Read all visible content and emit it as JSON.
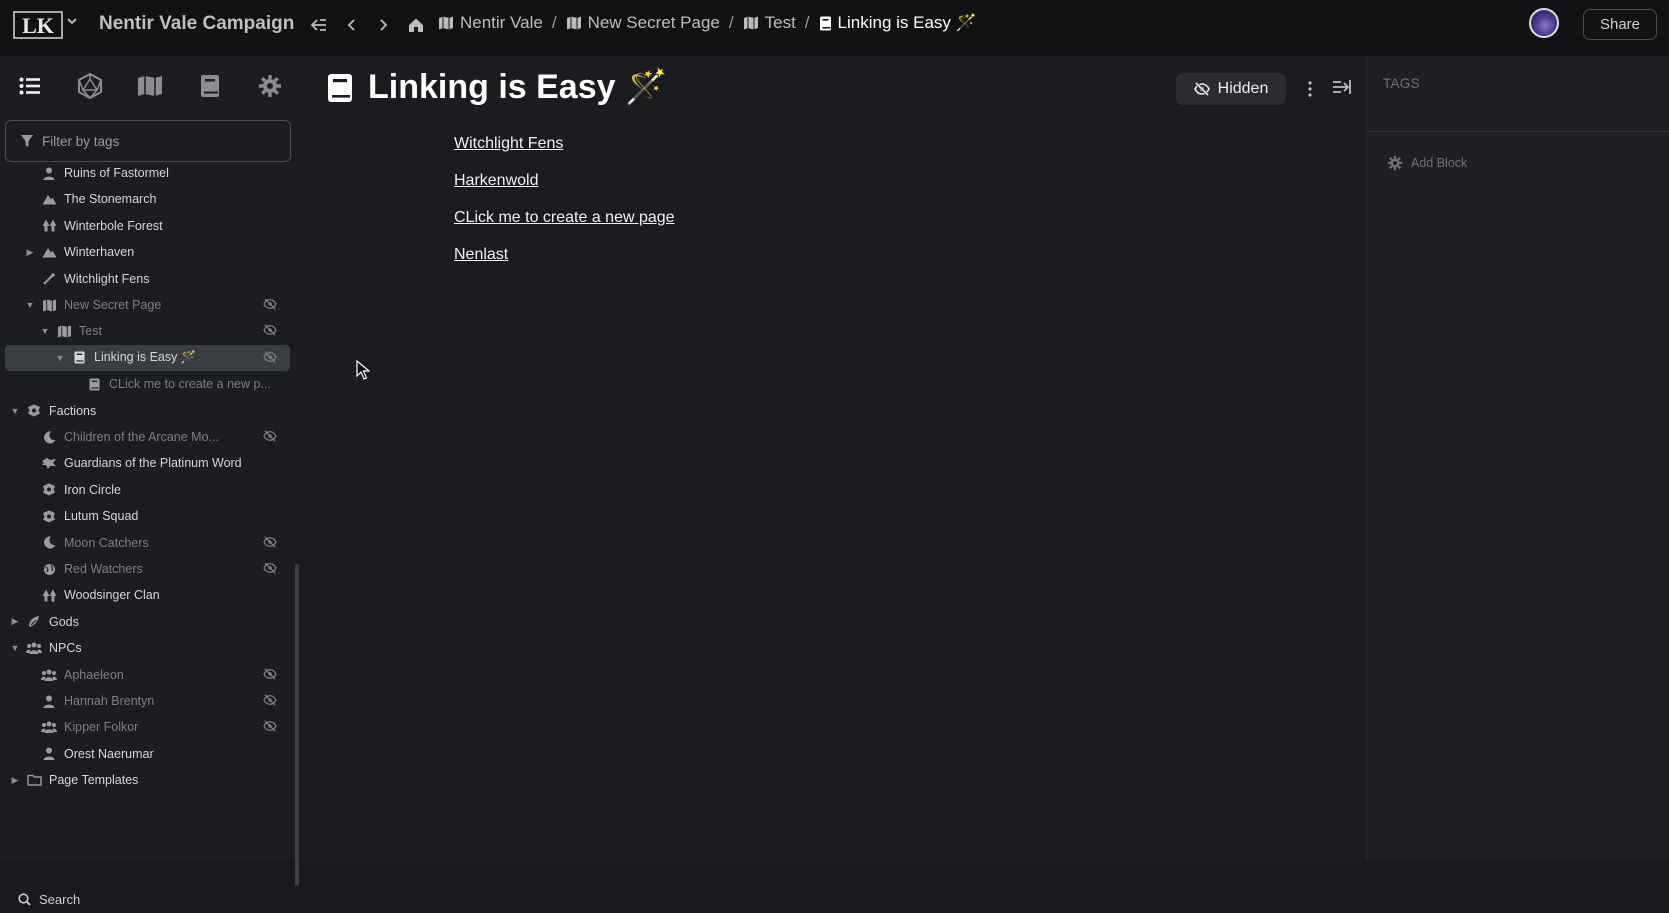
{
  "topbar": {
    "logo_text": "LK",
    "campaign_name": "Nentir Vale Campaign",
    "breadcrumbs": [
      {
        "label": "Nentir Vale",
        "icon": "map-icon"
      },
      {
        "label": "New Secret Page",
        "icon": "map-icon"
      },
      {
        "label": "Test",
        "icon": "map-icon"
      },
      {
        "label": "Linking is Easy 🪄",
        "icon": "book-icon"
      }
    ],
    "separator": "/",
    "share_label": "Share"
  },
  "sidebar": {
    "filter_placeholder": "Filter by tags",
    "search_label": "Search",
    "tree": [
      {
        "label": "Ruins of Fastormel",
        "icon": "person-icon",
        "indent": 1,
        "dim": false
      },
      {
        "label": "The Stonemarch",
        "icon": "mountain-icon",
        "indent": 1
      },
      {
        "label": "Winterbole Forest",
        "icon": "tree-icon",
        "indent": 1
      },
      {
        "label": "Winterhaven",
        "icon": "mountain-icon",
        "indent": 1,
        "caret": "right"
      },
      {
        "label": "Witchlight Fens",
        "icon": "wand-icon",
        "indent": 1
      },
      {
        "label": "New Secret Page",
        "icon": "map-icon",
        "indent": 1,
        "caret": "down",
        "dim": true,
        "hidden": true
      },
      {
        "label": "Test",
        "icon": "map-icon",
        "indent": 2,
        "caret": "down",
        "dim": true,
        "hidden": true
      },
      {
        "label": "Linking is Easy 🪄",
        "icon": "book-icon",
        "indent": 3,
        "caret": "down",
        "selected": true,
        "hidden": true
      },
      {
        "label": "CLick me to create a new p...",
        "icon": "book-icon",
        "indent": 4,
        "dim": true
      },
      {
        "label": "Factions",
        "icon": "faction-icon",
        "indent": 0,
        "caret": "down"
      },
      {
        "label": "Children of the Arcane Mo...",
        "icon": "moon-icon",
        "indent": 1,
        "dim": true,
        "hidden": true
      },
      {
        "label": "Guardians of the Platinum Word",
        "icon": "dragon-icon",
        "indent": 1
      },
      {
        "label": "Iron Circle",
        "icon": "faction-icon",
        "indent": 1
      },
      {
        "label": "Lutum Squad",
        "icon": "faction-icon",
        "indent": 1
      },
      {
        "label": "Moon Catchers",
        "icon": "moon-icon",
        "indent": 1,
        "dim": true,
        "hidden": true
      },
      {
        "label": "Red Watchers",
        "icon": "globe-icon",
        "indent": 1,
        "dim": true,
        "hidden": true
      },
      {
        "label": "Woodsinger Clan",
        "icon": "tree-icon",
        "indent": 1
      },
      {
        "label": "Gods",
        "icon": "god-icon",
        "indent": 0,
        "caret": "right"
      },
      {
        "label": "NPCs",
        "icon": "group-icon",
        "indent": 0,
        "caret": "down"
      },
      {
        "label": "Aphaeleon",
        "icon": "group-icon",
        "indent": 1,
        "dim": true,
        "hidden": true
      },
      {
        "label": "Hannah Brentyn",
        "icon": "person-icon",
        "indent": 1,
        "dim": true,
        "hidden": true
      },
      {
        "label": "Kipper Folkor",
        "icon": "group-icon",
        "indent": 1,
        "dim": true,
        "hidden": true
      },
      {
        "label": "Orest Naerumar",
        "icon": "person-icon",
        "indent": 1
      },
      {
        "label": "Page Templates",
        "icon": "folder-icon",
        "indent": 0,
        "caret": "right"
      }
    ]
  },
  "main": {
    "title": "Linking is Easy 🪄",
    "visibility_label": "Hidden",
    "links": [
      "Witchlight Fens",
      "Harkenwold",
      "CLick me to create a new page",
      "Nenlast"
    ]
  },
  "rightpanel": {
    "tags_label": "TAGS",
    "add_block_label": "Add Block"
  }
}
